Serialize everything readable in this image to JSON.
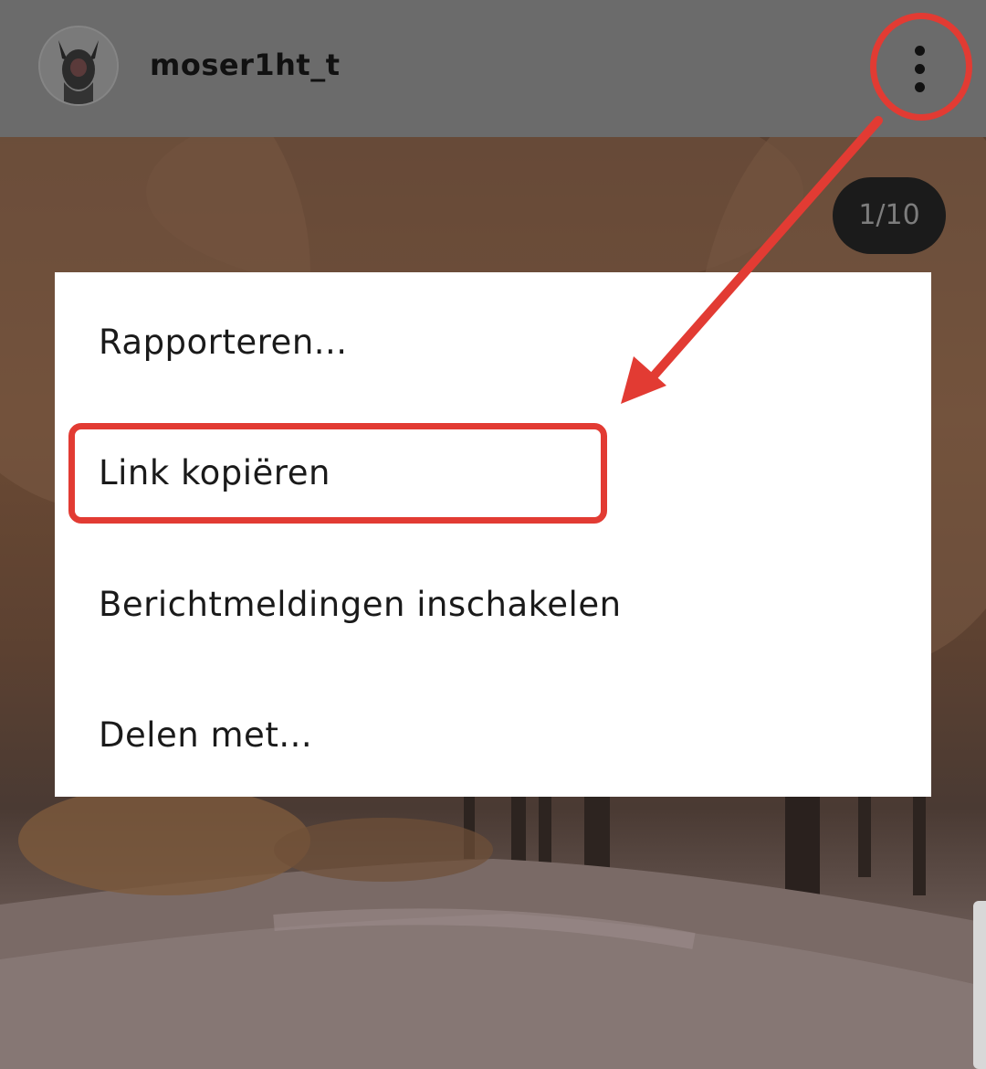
{
  "header": {
    "username": "moser1ht_t"
  },
  "post": {
    "counter": "1/10"
  },
  "menu": {
    "items": [
      {
        "label": "Rapporteren..."
      },
      {
        "label": "Link kopiëren"
      },
      {
        "label": "Berichtmeldingen inschakelen"
      },
      {
        "label": "Delen met..."
      }
    ]
  },
  "icons": {
    "more": "more-vertical-icon",
    "avatar": "avatar-image"
  },
  "colors": {
    "annotation": "#e23b33",
    "header_bg": "#6b6b6b",
    "menu_bg": "#ffffff"
  }
}
